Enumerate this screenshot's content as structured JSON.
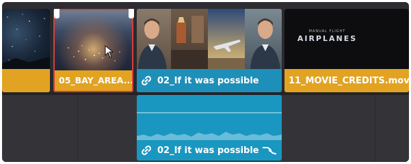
{
  "timeline": {
    "video_clips": [
      {
        "label": ""
      },
      {
        "label": "05_BAY_AREA...",
        "selected": true
      },
      {
        "label": "02_If it was possible",
        "linked": true
      },
      {
        "label": "11_MOVIE_CREDITS.mov"
      }
    ],
    "credits_title": "AIRPLANES",
    "credits_small_text": "MANUAL FLIGHT",
    "audio_clip": {
      "label": "02_If it was possible",
      "linked": true
    }
  },
  "colors": {
    "video_clip": "#e2a323",
    "linked_clip": "#1e8fb8",
    "selection": "#d6403c",
    "track_bg": "#2a2a2e"
  }
}
